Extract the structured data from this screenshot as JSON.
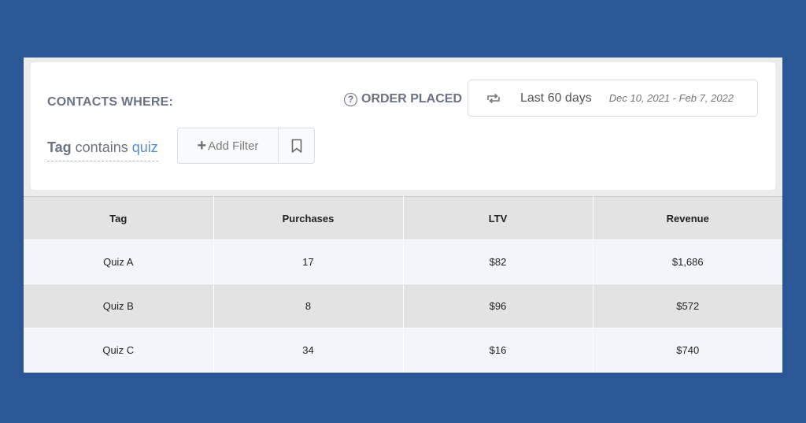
{
  "filters": {
    "contacts_where": "CONTACTS WHERE:",
    "order_placed": "ORDER PLACED",
    "help_glyph": "?",
    "date_preset": "Last 60 days",
    "date_range": "Dec 10, 2021 - Feb 7, 2022",
    "tag_key": "Tag",
    "tag_op": " contains ",
    "tag_value": "quiz",
    "add_filter_label": "Add Filter",
    "add_filter_glyph": "+",
    "icons": [
      "help-icon",
      "repeat-icon",
      "plus-icon",
      "bookmark-icon"
    ]
  },
  "table": {
    "headers": [
      "Tag",
      "Purchases",
      "LTV",
      "Revenue"
    ],
    "rows": [
      [
        "Quiz A",
        "17",
        "$82",
        "$1,686"
      ],
      [
        "Quiz B",
        "8",
        "$96",
        "$572"
      ],
      [
        "Quiz C",
        "34",
        "$16",
        "$740"
      ]
    ]
  },
  "colors": {
    "background": "#2b5797",
    "accent_link": "#4a90e2",
    "header_row": "#e3e3e3",
    "alt_row": "#f2f6fa"
  }
}
